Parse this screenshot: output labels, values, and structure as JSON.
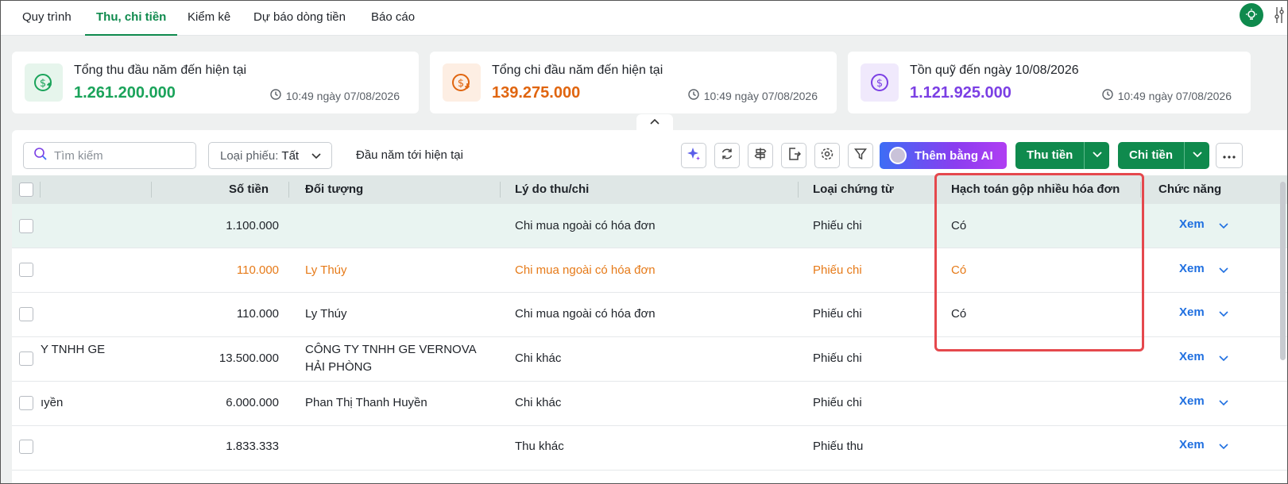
{
  "nav": {
    "tabs": [
      {
        "label": "Quy trình"
      },
      {
        "label": "Thu, chi tiền"
      },
      {
        "label": "Kiểm kê"
      },
      {
        "label": "Dự báo dòng tiền"
      },
      {
        "label": "Báo cáo"
      }
    ],
    "active_tab": "Thu, chi tiền"
  },
  "cards": [
    {
      "title": "Tổng thu đầu năm đến hiện tại",
      "amount": "1.261.200.000",
      "time": "10:49 ngày 07/08/2026",
      "color": "#1aa35a"
    },
    {
      "title": "Tổng chi đầu năm đến hiện tại",
      "amount": "139.275.000",
      "time": "10:49 ngày 07/08/2026",
      "color": "#e0650f"
    },
    {
      "title": "Tồn quỹ đến ngày 10/08/2026",
      "amount": "1.121.925.000",
      "time": "10:49 ngày 07/08/2026",
      "color": "#7b3fe4"
    }
  ],
  "toolbar": {
    "search_placeholder": "Tìm kiếm",
    "voucher_type_label": "Loại phiếu:",
    "voucher_type_value": "Tất",
    "period": "Đầu năm tới hiện tại",
    "ai_button": "Thêm bằng AI",
    "receive_button": "Thu tiền",
    "pay_button": "Chi tiền"
  },
  "table": {
    "headers": {
      "amount": "Số tiền",
      "object": "Đối tượng",
      "reason": "Lý do thu/chi",
      "doc_type": "Loại chứng từ",
      "combined": "Hạch toán gộp nhiều hóa đơn",
      "actions": "Chức năng"
    },
    "rows": [
      {
        "col1": "",
        "amount": "1.100.000",
        "object": "",
        "object2": "",
        "reason": "Chi mua ngoài có hóa đơn",
        "doc_type": "Phiếu chi",
        "combined": "Có",
        "action": "Xem"
      },
      {
        "col1": "",
        "amount": "110.000",
        "object": "Ly Thúy",
        "object2": "",
        "reason": "Chi mua ngoài có hóa đơn",
        "doc_type": "Phiếu chi",
        "combined": "Có",
        "action": "Xem"
      },
      {
        "col1": "",
        "amount": "110.000",
        "object": "Ly Thúy",
        "object2": "",
        "reason": "Chi mua ngoài có hóa đơn",
        "doc_type": "Phiếu chi",
        "combined": "Có",
        "action": "Xem"
      },
      {
        "col1": "Y TNHH GE",
        "amount": "13.500.000",
        "object": "CÔNG TY TNHH GE VERNOVA",
        "object2": "HẢI PHÒNG",
        "reason": "Chi khác",
        "doc_type": "Phiếu chi",
        "combined": "",
        "action": "Xem"
      },
      {
        "col1": "ıyền",
        "amount": "6.000.000",
        "object": "Phan Thị Thanh Huyền",
        "object2": "",
        "reason": "Chi khác",
        "doc_type": "Phiếu chi",
        "combined": "",
        "action": "Xem"
      },
      {
        "col1": "",
        "amount": "1.833.333",
        "object": "",
        "object2": "",
        "reason": "Thu khác",
        "doc_type": "Phiếu thu",
        "combined": "",
        "action": "Xem"
      }
    ]
  },
  "colors": {
    "brand": "#0f8a4d",
    "highlight": "#e67a18",
    "link": "#1f6fe0",
    "annotation": "#e5484d"
  }
}
